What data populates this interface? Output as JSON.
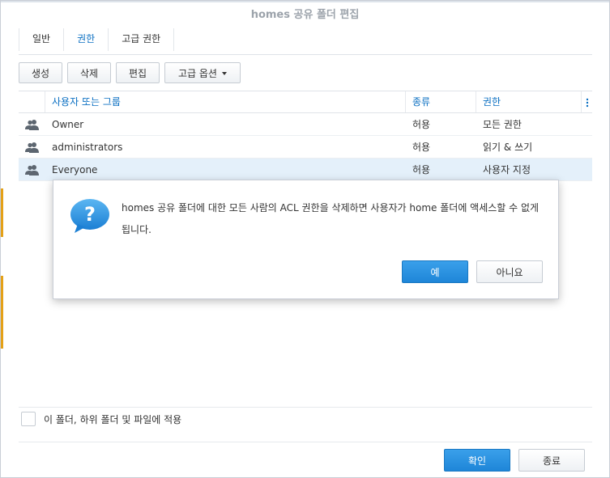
{
  "window": {
    "title": "homes 공유 폴더 편집"
  },
  "tabs": [
    {
      "label": "일반",
      "active": false
    },
    {
      "label": "권한",
      "active": true
    },
    {
      "label": "고급 권한",
      "active": false
    }
  ],
  "toolbar": {
    "create_label": "생성",
    "delete_label": "삭제",
    "edit_label": "편집",
    "advanced_label": "고급 옵션"
  },
  "grid": {
    "columns": {
      "name": "사용자 또는 그룹",
      "type": "종류",
      "permission": "권한",
      "menu_icon": "column-menu-icon"
    },
    "rows": [
      {
        "name": "Owner",
        "type": "허용",
        "permission": "모든 권한",
        "icon": "user-group-icon",
        "selected": false
      },
      {
        "name": "administrators",
        "type": "허용",
        "permission": "읽기 & 쓰기",
        "icon": "user-group-icon",
        "selected": false
      },
      {
        "name": "Everyone",
        "type": "허용",
        "permission": "사용자 지정",
        "icon": "user-group-icon",
        "selected": true
      }
    ]
  },
  "apply": {
    "label": "이 폴더, 하위 폴더 및 파일에 적용",
    "checked": false
  },
  "footer": {
    "ok_label": "확인",
    "close_label": "종료"
  },
  "modal": {
    "icon": "question-icon",
    "message": "homes 공유 폴더에 대한 모든 사람의 ACL 권한을 삭제하면 사용자가 home 폴더에 액세스할 수 없게 됩니다.",
    "yes_label": "예",
    "no_label": "아니요"
  },
  "colors": {
    "accent": "#0a6fc2",
    "primary_button": "#2a93e2",
    "selected_row": "#e4f0fa",
    "left_edge_accent": "#e4a118"
  }
}
